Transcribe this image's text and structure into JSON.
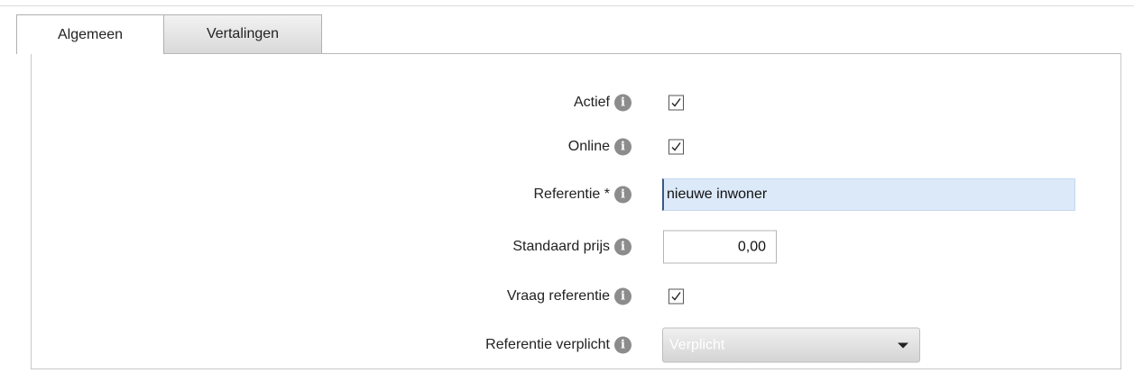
{
  "tabs": [
    {
      "label": "Algemeen",
      "active": true
    },
    {
      "label": "Vertalingen",
      "active": false
    }
  ],
  "form": {
    "actief": {
      "label": "Actief",
      "checked": true
    },
    "online": {
      "label": "Online",
      "checked": true
    },
    "referentie": {
      "label": "Referentie *",
      "value": "nieuwe inwoner"
    },
    "standaard_prijs": {
      "label": "Standaard prijs",
      "value": "0,00"
    },
    "vraag_referentie": {
      "label": "Vraag referentie",
      "checked": true
    },
    "referentie_verplicht": {
      "label": "Referentie verplicht",
      "selected": "Verplicht"
    }
  },
  "icons": {
    "info": "info-icon",
    "check": "checkmark-icon",
    "dropdown": "chevron-down-icon"
  },
  "colors": {
    "input_focus_bg": "#dce9f9",
    "info_icon": "#8c8c8c",
    "select_bg": "#d9d9d9"
  }
}
